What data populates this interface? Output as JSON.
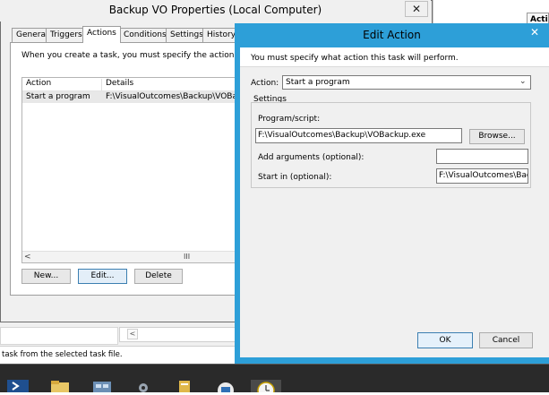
{
  "properties_window": {
    "title": "Backup VO Properties (Local Computer)",
    "close_glyph": "✕",
    "tabs": [
      "General",
      "Triggers",
      "Actions",
      "Conditions",
      "Settings",
      "History"
    ],
    "active_tab": "Actions",
    "instruction": "When you create a task, you must specify the action that wil",
    "table": {
      "columns": [
        "Action",
        "Details"
      ],
      "rows": [
        {
          "action": "Start a program",
          "details": "F:\\VisualOutcomes\\Backup\\VOBackup"
        }
      ]
    },
    "scroll_left_glyph": "<",
    "scroll_thumb_glyph": "III",
    "buttons": {
      "new": "New...",
      "edit": "Edit...",
      "delete": "Delete"
    }
  },
  "background": {
    "right_header": "Action",
    "status_text": "task from the selected task file.",
    "scroll_left_glyph": "<"
  },
  "edit_action": {
    "title": "Edit Action",
    "close_glyph": "✕",
    "instruction": "You must specify what action this task will perform.",
    "action_label": "Action:",
    "action_value": "Start a program",
    "select_arrow": "⌄",
    "settings_label": "Settings",
    "program_label": "Program/script:",
    "program_value": "F:\\VisualOutcomes\\Backup\\VOBackup.exe",
    "browse_label": "Browse...",
    "args_label": "Add arguments (optional):",
    "args_value": "",
    "start_in_label": "Start in (optional):",
    "start_in_value": "F:\\VisualOutcomes\\Back",
    "ok_label": "OK",
    "cancel_label": "Cancel"
  },
  "taskbar": {
    "icons": [
      "powershell-icon",
      "file-explorer-icon",
      "server-manager-icon",
      "settings-icon",
      "files-icon",
      "vm-icon",
      "task-scheduler-icon"
    ],
    "accent": "#2d9fd8"
  }
}
